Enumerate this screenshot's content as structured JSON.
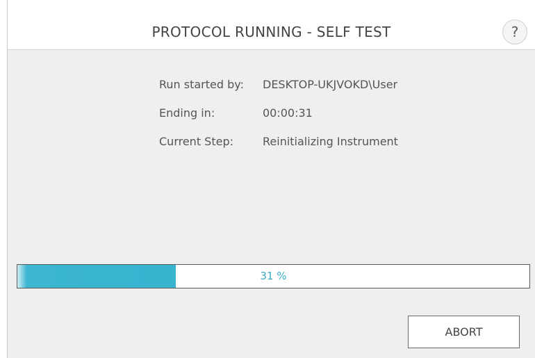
{
  "dialog": {
    "title": "PROTOCOL RUNNING - SELF TEST",
    "help_label": "?"
  },
  "run_info": {
    "started_by_label": "Run started by:",
    "started_by_value": "DESKTOP-UKJVOKD\\User",
    "ending_in_label": "Ending in:",
    "ending_in_value": "00:00:31",
    "current_step_label": "Current Step:",
    "current_step_value": "Reinitializing Instrument"
  },
  "progress": {
    "percent": 31,
    "label": "31 %"
  },
  "actions": {
    "abort_label": "ABORT"
  },
  "colors": {
    "accent": "#38b4cf",
    "background": "#efefef",
    "header": "#ffffff"
  }
}
